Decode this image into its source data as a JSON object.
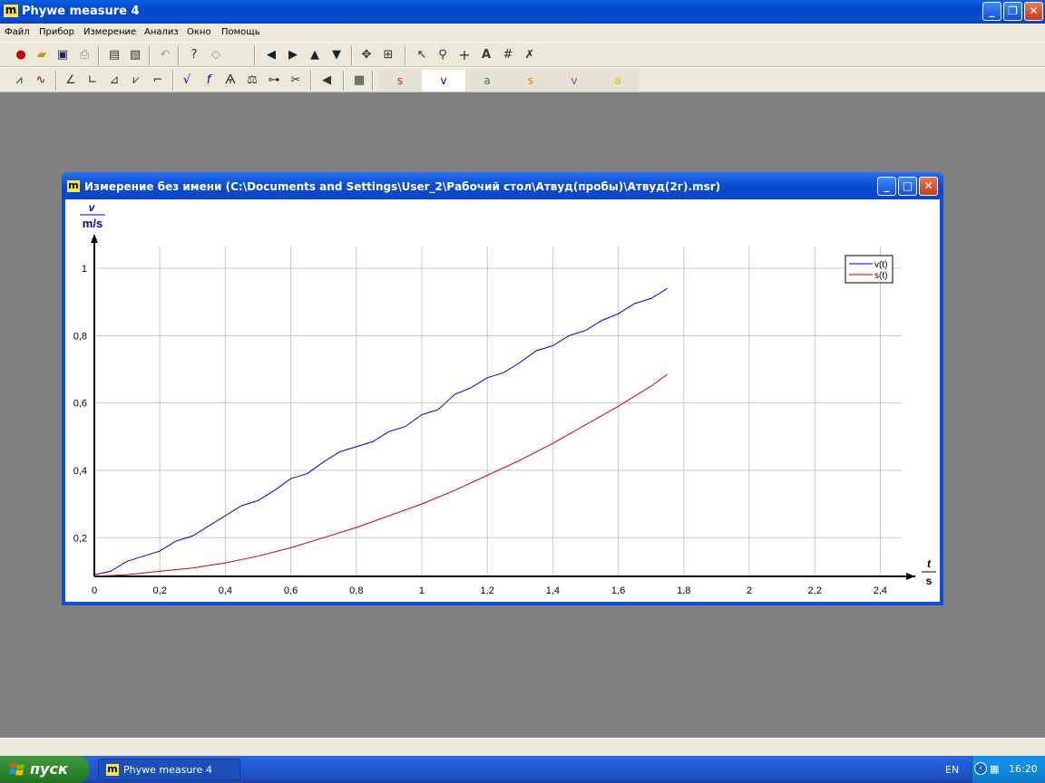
{
  "app": {
    "logo": "m",
    "title": "Phywe measure 4"
  },
  "menu": [
    "Файл",
    "Прибор",
    "Измерение",
    "Анализ",
    "Окно",
    "Помощь"
  ],
  "channels": [
    {
      "label": "s",
      "color": "#e02020"
    },
    {
      "label": "v",
      "color": "#0000cc"
    },
    {
      "label": "a",
      "color": "#2e8b2e"
    },
    {
      "label": "s",
      "color": "#f08000"
    },
    {
      "label": "v",
      "color": "#b030d0"
    },
    {
      "label": "a",
      "color": "#e8b020"
    }
  ],
  "measurement_window": {
    "logo": "m",
    "title": "Измерение без имени (C:\\Documents and Settings\\User_2\\Рабочий стол\\Атвуд(пробы)\\Атвуд(2г).msr)"
  },
  "chart_data": {
    "type": "line",
    "y_axis": {
      "symbol": "v",
      "unit": "m/s",
      "ticks": [
        "0,2",
        "0,4",
        "0,6",
        "0,8",
        "1"
      ],
      "range": [
        0.05,
        1.1
      ]
    },
    "x_axis": {
      "symbol": "t",
      "unit": "s",
      "ticks": [
        "0",
        "0,2",
        "0,4",
        "0,6",
        "0,8",
        "1",
        "1,2",
        "1,4",
        "1,6",
        "1,8",
        "2",
        "2,2",
        "2,4"
      ],
      "range": [
        0,
        2.5
      ]
    },
    "grid": true,
    "legend_position": "top-right",
    "series": [
      {
        "name": "v(t)",
        "color": "#0000cc",
        "x": [
          0,
          0.05,
          0.1,
          0.15,
          0.2,
          0.25,
          0.3,
          0.35,
          0.4,
          0.45,
          0.5,
          0.55,
          0.6,
          0.65,
          0.7,
          0.75,
          0.8,
          0.85,
          0.9,
          0.95,
          1.0,
          1.05,
          1.1,
          1.15,
          1.2,
          1.25,
          1.3,
          1.35,
          1.4,
          1.45,
          1.5,
          1.55,
          1.6,
          1.65,
          1.7,
          1.75
        ],
        "y": [
          0.09,
          0.1,
          0.13,
          0.145,
          0.16,
          0.19,
          0.205,
          0.235,
          0.265,
          0.295,
          0.31,
          0.34,
          0.375,
          0.39,
          0.425,
          0.455,
          0.47,
          0.485,
          0.515,
          0.53,
          0.565,
          0.58,
          0.625,
          0.645,
          0.675,
          0.69,
          0.72,
          0.755,
          0.77,
          0.8,
          0.815,
          0.845,
          0.865,
          0.895,
          0.91,
          0.94
        ]
      },
      {
        "name": "s(t)",
        "color": "#cc0000",
        "x": [
          0,
          0.1,
          0.2,
          0.3,
          0.4,
          0.5,
          0.6,
          0.7,
          0.8,
          0.9,
          1.0,
          1.1,
          1.2,
          1.3,
          1.4,
          1.5,
          1.6,
          1.7,
          1.75
        ],
        "y": [
          0.085,
          0.09,
          0.1,
          0.11,
          0.125,
          0.145,
          0.17,
          0.2,
          0.23,
          0.265,
          0.3,
          0.34,
          0.385,
          0.43,
          0.48,
          0.535,
          0.59,
          0.65,
          0.685
        ]
      }
    ]
  },
  "taskbar": {
    "start_label": "пуск",
    "task_label": "Phywe measure 4",
    "task_logo": "m",
    "language": "EN",
    "clock": "16:20"
  }
}
